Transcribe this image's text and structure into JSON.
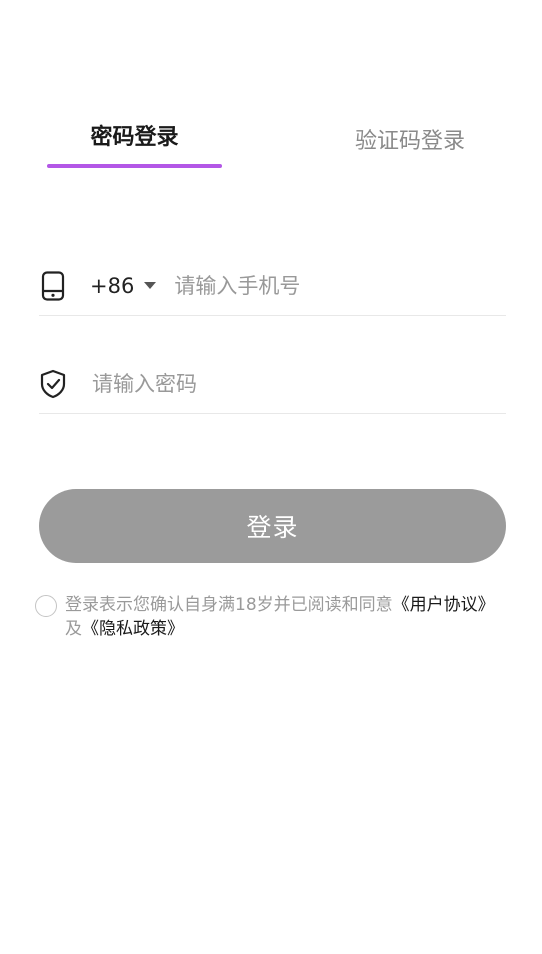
{
  "tabs": {
    "password_login": "密码登录",
    "code_login": "验证码登录",
    "active": "password_login"
  },
  "phone_field": {
    "country_code": "+86",
    "placeholder": "请输入手机号",
    "value": ""
  },
  "password_field": {
    "placeholder": "请输入密码",
    "value": ""
  },
  "login_button": {
    "label": "登录"
  },
  "agreement": {
    "checked": false,
    "prefix": "登录表示您确认自身满18岁并已阅读和同意",
    "user_agreement": "《用户协议》",
    "conjunction": "及",
    "privacy_policy": "《隐私政策》"
  },
  "colors": {
    "accent": "#b357e6",
    "button_disabled": "#9b9b9b",
    "placeholder": "#999999",
    "inactive_tab": "#8a8a8a"
  },
  "icons": {
    "phone": "phone-icon",
    "password": "shield-check-icon",
    "dropdown": "caret-down-icon"
  }
}
